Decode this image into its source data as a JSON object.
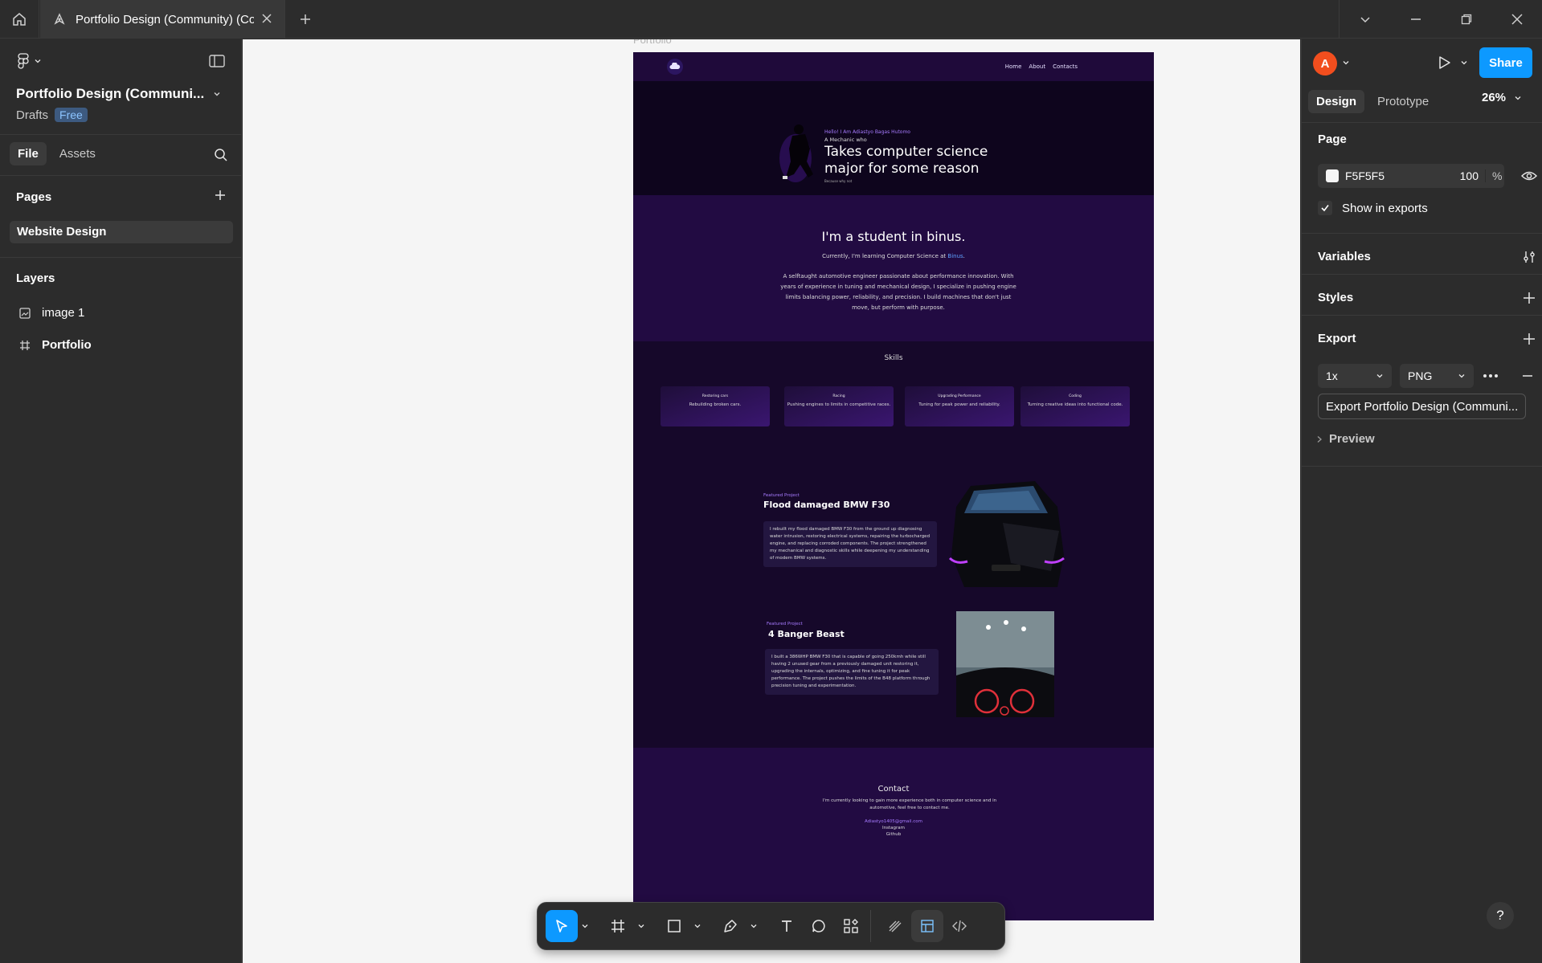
{
  "tab": {
    "title": "Portfolio Design (Community) (Co"
  },
  "project": {
    "title": "Portfolio Design (Communi...",
    "location": "Drafts",
    "plan_badge": "Free"
  },
  "left_panel": {
    "tabs": [
      "File",
      "Assets"
    ],
    "pages_heading": "Pages",
    "pages": [
      "Website Design"
    ],
    "layers_heading": "Layers",
    "layers": [
      {
        "name": "image 1",
        "icon": "image-icon"
      },
      {
        "name": "Portfolio",
        "icon": "frame-icon"
      }
    ]
  },
  "canvas": {
    "frame_label": "Portfolio",
    "site": {
      "nav": [
        "Home",
        "About",
        "Contacts"
      ],
      "hero": {
        "hello": "Hello! I Am Adiastyo Bagas Hutomo",
        "mechanic": "A Mechanic who",
        "headline": "Takes computer science major for some reason",
        "small": "Because why not"
      },
      "about": {
        "heading": "I'm a student in binus.",
        "sub_prefix": "Currently, I'm learning Computer Science at ",
        "sub_link": "Binus",
        "sub_suffix": ".",
        "paragraph": "A selftaught automotive engineer passionate about performance innovation. With years of experience in tuning and mechanical design, I specialize in pushing engine limits balancing power, reliability, and precision. I build machines that don't just move, but perform with purpose."
      },
      "skills": {
        "heading": "Skills",
        "cards": [
          {
            "title": "Restoring cars",
            "desc": "Rebuilding broken cars."
          },
          {
            "title": "Racing",
            "desc": "Pushing engines to limits in competitive races."
          },
          {
            "title": "Upgrading Performance",
            "desc": "Tuning for peak power and reliability."
          },
          {
            "title": "Coding",
            "desc": "Turning creative ideas into functional code."
          }
        ]
      },
      "projects": [
        {
          "tag": "Featured Project",
          "title": "Flood damaged BMW F30",
          "desc": "I rebuilt my flood damaged BMW F30 from the ground up diagnosing water intrusion, restoring electrical systems, repairing the turbocharged engine, and replacing corroded components. The project strengthened my mechanical and diagnostic skills while deepening my understanding of modern BMW systems."
        },
        {
          "tag": "Featured Project",
          "title": "4 Banger Beast",
          "desc": "I built a 386WHP BMW F30 that is capable of going 250kmh while still having 2 unused gear from a previously damaged unit restoring it, upgrading the internals, optimizing, and fine tuning it for peak performance. The project pushes the limits of the B48 platform through precision tuning and experimentation."
        }
      ],
      "contact": {
        "heading": "Contact",
        "paragraph": "I'm currently looking to gain more experience both in computer science and in automotive, feel free to contact me.",
        "email": "Adiastyo1405@gmail.com",
        "links": [
          "Instagram",
          "Github"
        ]
      }
    }
  },
  "toolbar": {
    "tools": [
      "move-tool",
      "frame-tool",
      "rectangle-tool",
      "pen-tool",
      "text-tool",
      "comment-tool",
      "actions-tool",
      "draw-mode",
      "design-mode",
      "dev-mode"
    ],
    "active": "move-tool"
  },
  "right_panel": {
    "avatar_initial": "A",
    "share_label": "Share",
    "tabs": [
      "Design",
      "Prototype"
    ],
    "zoom": "26%",
    "page_heading": "Page",
    "page_fill_hex": "F5F5F5",
    "page_fill_opacity": "100",
    "page_fill_unit": "%",
    "show_in_exports": "Show in exports",
    "variables_heading": "Variables",
    "styles_heading": "Styles",
    "export_heading": "Export",
    "export_scale": "1x",
    "export_format": "PNG",
    "export_button": "Export Portfolio Design (Communi...",
    "preview_label": "Preview",
    "help": "?"
  },
  "colors": {
    "accent": "#0d99ff",
    "panel_bg": "#2c2c2c",
    "canvas_bg": "#f5f5f5",
    "site_bg": "#16082a",
    "site_accent": "#a77bff",
    "avatar": "#f24e1e"
  }
}
